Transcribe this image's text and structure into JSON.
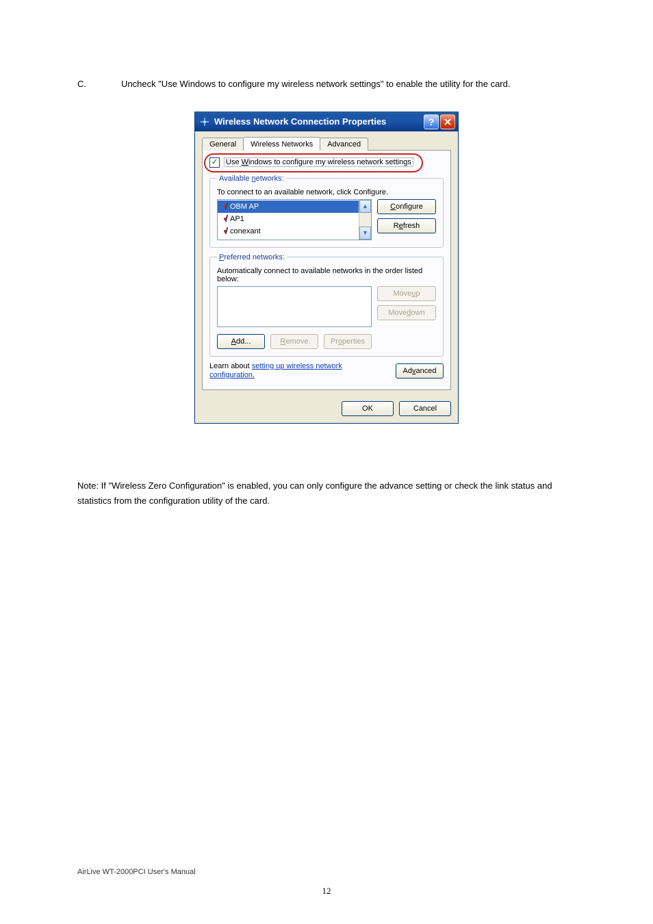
{
  "instruction": {
    "marker": "C.",
    "text": "Uncheck \"Use Windows to configure my wireless network settings\" to enable the utility for the card."
  },
  "dialog": {
    "title": "Wireless Network Connection Properties",
    "tabs": {
      "general": "General",
      "wireless": "Wireless Networks",
      "advanced": "Advanced"
    },
    "checkbox_pre": "Use ",
    "checkbox_u": "W",
    "checkbox_post": "indows to configure my wireless network settings",
    "available": {
      "legend_pre": "Available ",
      "legend_u": "n",
      "legend_post": "etworks:",
      "desc": "To connect to an available network, click Configure.",
      "items": [
        "OBM AP",
        "AP1",
        "conexant"
      ],
      "configure_u": "C",
      "configure_post": "onfigure",
      "refresh_pre": "R",
      "refresh_u": "e",
      "refresh_post": "fresh"
    },
    "preferred": {
      "legend_u": "P",
      "legend_post": "referred networks:",
      "desc": "Automatically connect to available networks in the order listed below:",
      "moveup_pre": "Move ",
      "moveup_u": "u",
      "moveup_post": "p",
      "movedown_pre": "Move ",
      "movedown_u": "d",
      "movedown_post": "own",
      "add_u": "A",
      "add_post": "dd...",
      "remove_u": "R",
      "remove_post": "emove",
      "props_pre": "Pr",
      "props_u": "o",
      "props_post": "perties"
    },
    "learn_pre": "Learn about ",
    "learn_link1": "setting up wireless network",
    "learn_link2": "configuration.",
    "advanced_btn_pre": "Ad",
    "advanced_btn_u": "v",
    "advanced_btn_post": "anced",
    "ok": "OK",
    "cancel": "Cancel"
  },
  "note": "Note: If \"Wireless Zero Configuration\" is enabled, you can only configure the advance setting or check the link status and statistics from the configuration utility of the card.",
  "footer": "AirLive WT-2000PCI User's Manual",
  "pagenum": "12"
}
